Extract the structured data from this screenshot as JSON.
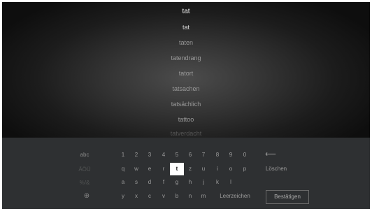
{
  "query": "tat",
  "suggestions": [
    "tat",
    "taten",
    "tatendrang",
    "tatort",
    "tatsachen",
    "tatsächlich",
    "tattoo",
    "tatverdacht"
  ],
  "keyboard": {
    "modes": [
      "abc",
      "ÄÖÜ",
      "%/&",
      "globe-icon"
    ],
    "rows": [
      [
        "1",
        "2",
        "3",
        "4",
        "5",
        "6",
        "7",
        "8",
        "9",
        "0"
      ],
      [
        "q",
        "w",
        "e",
        "r",
        "t",
        "z",
        "u",
        "i",
        "o",
        "p"
      ],
      [
        "a",
        "s",
        "d",
        "f",
        "g",
        "h",
        "j",
        "k",
        "l"
      ],
      [
        "y",
        "x",
        "c",
        "v",
        "b",
        "n",
        "m"
      ]
    ],
    "selected_key": "t",
    "backspace_icon": "backspace-arrow-icon",
    "backspace_symbol": "⟵",
    "delete_label": "Löschen",
    "space_label": "Leerzeichen",
    "confirm_label": "Bestätigen",
    "globe_symbol": "⊕"
  }
}
